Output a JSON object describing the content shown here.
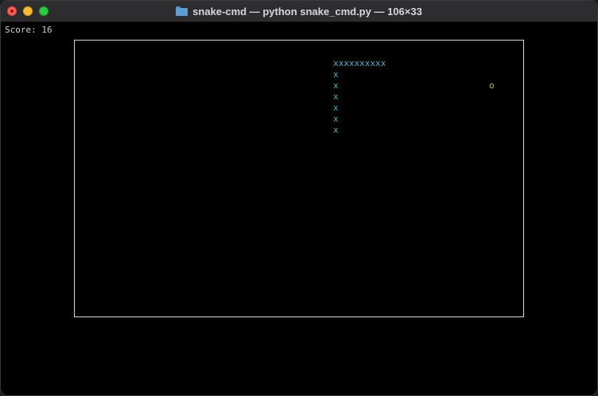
{
  "window": {
    "title": "snake-cmd — python snake_cmd.py — 106×33"
  },
  "terminal": {
    "score_text": "Score: 16",
    "snake": {
      "head_row": "xxxxxxxxxx",
      "body": [
        "x",
        "x",
        "x",
        "x",
        "x",
        "x"
      ]
    },
    "food": "o"
  },
  "colors": {
    "background": "#000000",
    "snake": "#41b8c8",
    "food": "#c7b83a",
    "border": "#d6d6d6"
  },
  "icons": {
    "title": "folder-icon"
  }
}
